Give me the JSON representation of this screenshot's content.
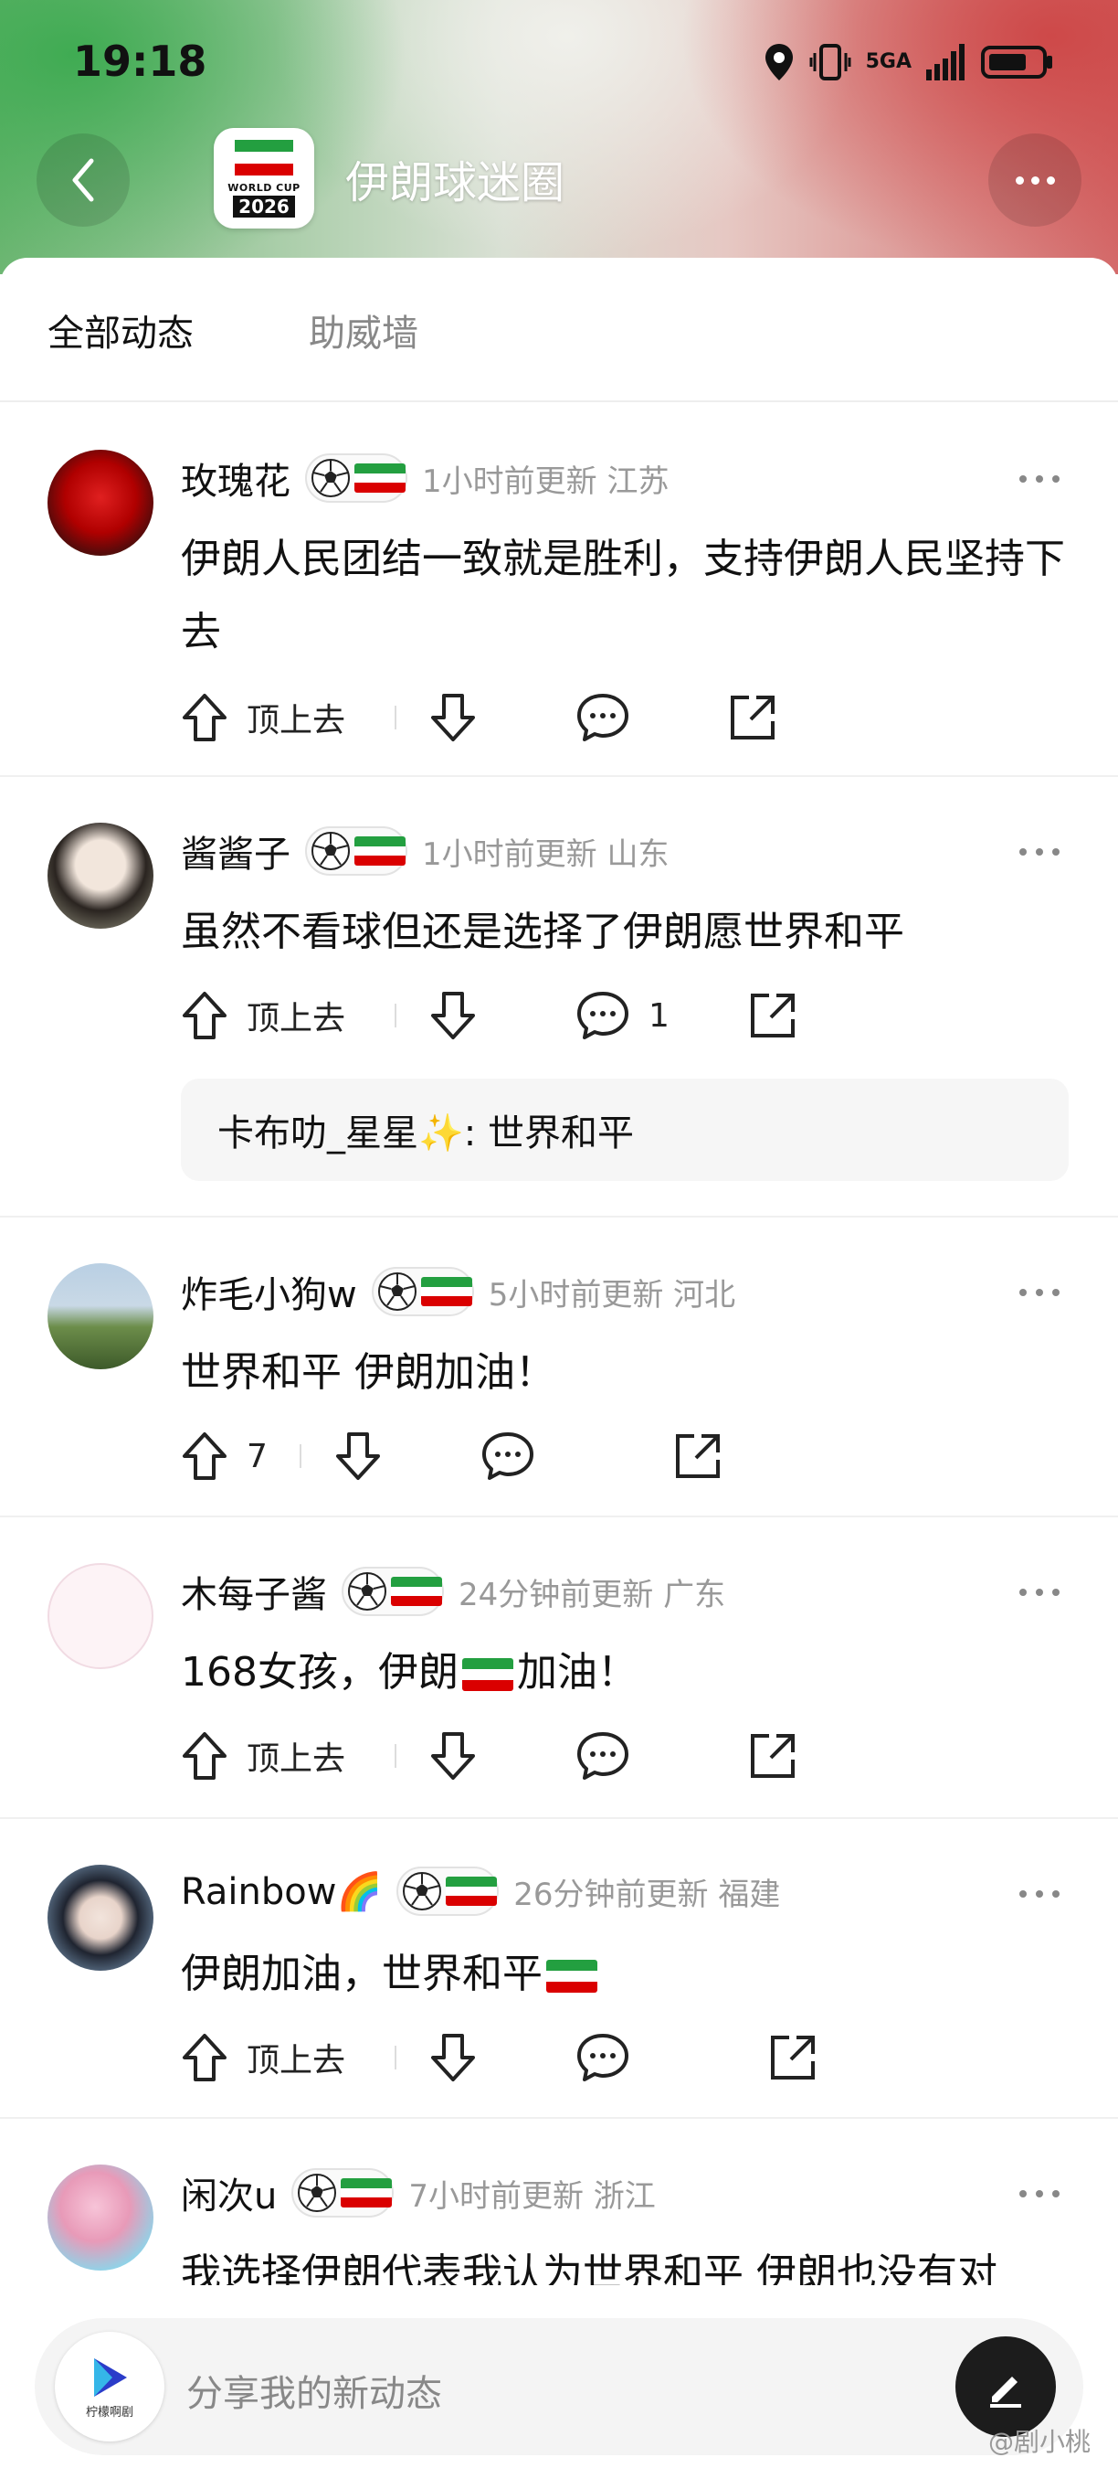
{
  "status": {
    "time": "19:18",
    "network": "5GA"
  },
  "header": {
    "title": "伊朗球迷圈",
    "logo_text_top": "WORLD CUP",
    "logo_text_year": "2026"
  },
  "tabs": [
    {
      "label": "全部动态"
    },
    {
      "label": "助威墙"
    }
  ],
  "posts": [
    {
      "user": "玫瑰花",
      "meta": "1小时前更新 江苏",
      "text": "伊朗人民团结一致就是胜利，支持伊朗人民坚持下去",
      "up_label": "顶上去",
      "comments": ""
    },
    {
      "user": "酱酱子",
      "meta": "1小时前更新 山东",
      "text": "虽然不看球但还是选择了伊朗愿世界和平",
      "up_label": "顶上去",
      "comments": "1",
      "reply": "卡布叻_星星✨: 世界和平"
    },
    {
      "user": "炸毛小狗w",
      "meta": "5小时前更新 河北",
      "text": "世界和平 伊朗加油！",
      "up_label": "7",
      "comments": ""
    },
    {
      "user": "木每子酱",
      "meta": "24分钟前更新 广东",
      "text_before": "168女孩，伊朗",
      "text_after": "加油！",
      "up_label": "顶上去",
      "comments": ""
    },
    {
      "user": "Rainbow🌈",
      "meta": "26分钟前更新 福建",
      "text_before": "伊朗加油，世界和平",
      "text_after": "",
      "up_label": "顶上去",
      "comments": ""
    },
    {
      "user": "闲次u",
      "meta": "7小时前更新 浙江",
      "text": "我选择伊朗代表我认为世界和平 伊朗也没有对"
    }
  ],
  "composer": {
    "placeholder": "分享我的新动态",
    "logo_label": "柠檬啊剧"
  },
  "watermark": "@剧小桃",
  "colors": {
    "iran_green": "#239f40",
    "iran_red": "#da0000",
    "composer_button": "#1c1c1c"
  }
}
